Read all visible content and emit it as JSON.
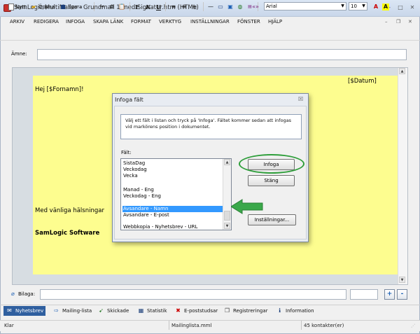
{
  "window": {
    "title": "SamLogic MultiMailer - Grundmall 1 med Signatur.htm  (HTML)",
    "controls": [
      "–",
      "□",
      "✕"
    ]
  },
  "menu": [
    "ARKIV",
    "REDIGERA",
    "INFOGA",
    "SKAPA LÄNK",
    "FORMAT",
    "VERKTYG",
    "INSTÄLLNINGAR",
    "FÖNSTER",
    "HJÄLP"
  ],
  "toolbar": {
    "new_label": "Nytt",
    "open_label": "Öppna",
    "save_label": "Spara",
    "bold": "F",
    "italic": "K",
    "underline": "U",
    "font_value": "Arial",
    "size_value": "10"
  },
  "subject": {
    "label": "Ämne:",
    "value": ""
  },
  "document": {
    "greeting": "Hej [$Fornamn]!",
    "date_field": "[$Datum]",
    "closing": "Med vänliga hälsningar",
    "signature": "SamLogic Software"
  },
  "dialog": {
    "title": "Infoga fält",
    "close": "☒",
    "info_line1": "Välj ett fält i listan och tryck på 'Infoga'. Fältet kommer sedan att infogas",
    "info_line2": "vid markörens position i dokumentet.",
    "field_label": "Fält:",
    "fields": [
      {
        "label": "SistaDag",
        "selected": false
      },
      {
        "label": "Veckodag",
        "selected": false
      },
      {
        "label": "Vecka",
        "selected": false
      },
      {
        "label": "",
        "selected": false
      },
      {
        "label": "Manad - Eng",
        "selected": false
      },
      {
        "label": "Veckodag - Eng",
        "selected": false
      },
      {
        "label": "",
        "selected": false
      },
      {
        "label": "Avsandare - Namn",
        "selected": true
      },
      {
        "label": "Avsandare - E-post",
        "selected": false
      },
      {
        "label": "",
        "selected": false
      },
      {
        "label": "Webbkopia - Nyhetsbrev - URL",
        "selected": false
      }
    ],
    "insert_button": "Infoga",
    "close_button": "Stäng",
    "settings_button": "Inställningar..."
  },
  "attachment": {
    "label": "Bilaga:",
    "value": "",
    "add": "+",
    "remove": "-"
  },
  "tabs": [
    {
      "label": "Nyhetsbrev",
      "icon": "newsletter-icon",
      "glyph": "✉",
      "active": true
    },
    {
      "label": "Mailing-lista",
      "icon": "mailing-list-icon",
      "glyph": "⇨",
      "active": false
    },
    {
      "label": "Skickade",
      "icon": "sent-icon",
      "glyph": "➹",
      "active": false
    },
    {
      "label": "Statistik",
      "icon": "statistics-icon",
      "glyph": "▦",
      "active": false
    },
    {
      "label": "E-poststudsar",
      "icon": "bounce-icon",
      "glyph": "✖",
      "active": false
    },
    {
      "label": "Registreringar",
      "icon": "registrations-icon",
      "glyph": "❐",
      "active": false
    },
    {
      "label": "Information",
      "icon": "information-icon",
      "glyph": "ℹ",
      "active": false
    }
  ],
  "status": {
    "left": "Klar",
    "middle": "Mailinglista.mml",
    "right": "45 kontakter(er)"
  },
  "colors": {
    "document_bg": "#fdfd8f",
    "highlight_green": "#2e9e3a",
    "selection": "#3399ff",
    "active_tab": "#2f5f9f"
  }
}
